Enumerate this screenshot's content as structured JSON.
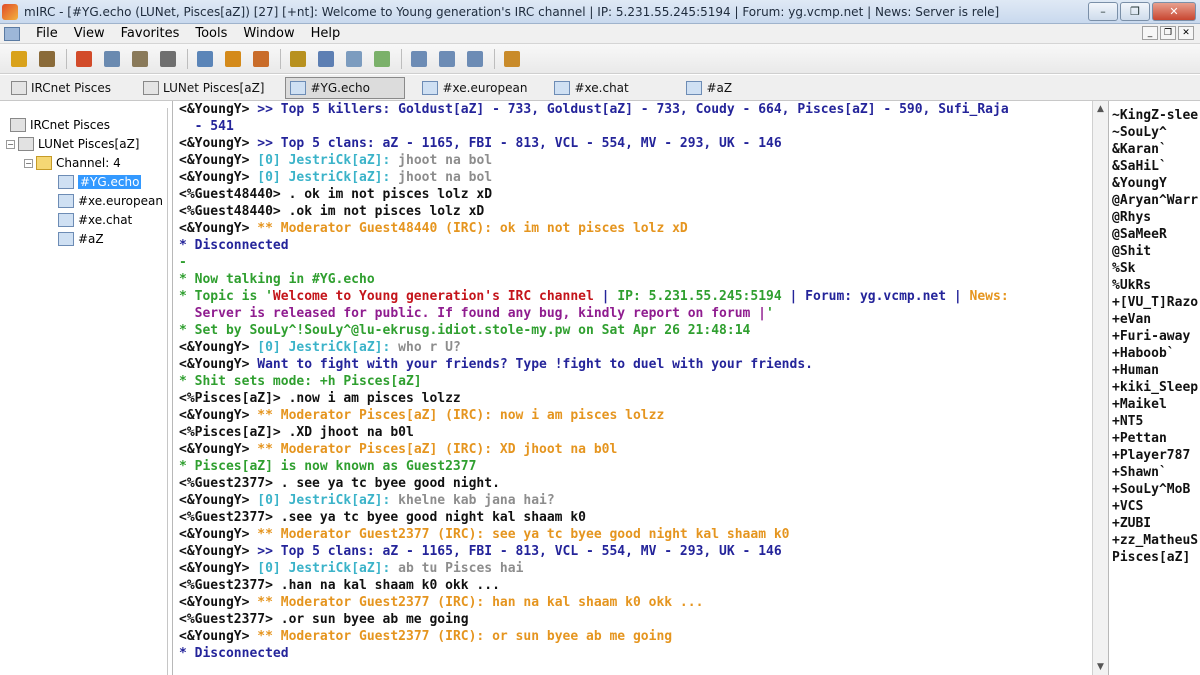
{
  "window": {
    "title": "mIRC - [#YG.echo (LUNet, Pisces[aZ]) [27] [+nt]: Welcome to Young generation's IRC channel | IP: 5.231.55.245:5194 | Forum: yg.vcmp.net | News: Server is rele]",
    "minimize": "–",
    "maximize": "❐",
    "close": "✕"
  },
  "menu": {
    "items": [
      "File",
      "View",
      "Favorites",
      "Tools",
      "Window",
      "Help"
    ],
    "mdi": [
      "_",
      "❐",
      "✕"
    ]
  },
  "toolbar": {
    "buttons": [
      {
        "icon": "connect-icon",
        "color": "#d9a21b"
      },
      {
        "icon": "options-icon",
        "color": "#8a6b3a"
      },
      {
        "icon": "favorites-icon",
        "color": "#d24b2a"
      },
      {
        "icon": "address-book-icon",
        "color": "#6a8ab0"
      },
      {
        "icon": "scripts-editor-icon",
        "color": "#8a7a5a"
      },
      {
        "icon": "colors-icon",
        "color": "#6f6f6f"
      },
      {
        "icon": "timer-icon",
        "color": "#5b85b8"
      },
      {
        "icon": "channel-list-icon",
        "color": "#d48a1a"
      },
      {
        "icon": "channel-folder-icon",
        "color": "#c96c2a"
      },
      {
        "icon": "dcc-send-icon",
        "color": "#b8911f"
      },
      {
        "icon": "dcc-chat-icon",
        "color": "#5d7fb3"
      },
      {
        "icon": "notify-list-icon",
        "color": "#7c9cbf"
      },
      {
        "icon": "url-list-icon",
        "color": "#7bb16a"
      },
      {
        "icon": "tile-horizontal-icon",
        "color": "#6d8cb5"
      },
      {
        "icon": "tile-vertical-icon",
        "color": "#6d8cb5"
      },
      {
        "icon": "cascade-icon",
        "color": "#6d8cb5"
      },
      {
        "icon": "help-icon",
        "color": "#c98b2a"
      }
    ]
  },
  "switchbar": {
    "tabs": [
      {
        "label": "IRCnet Pisces",
        "type": "server",
        "active": false
      },
      {
        "label": "LUNet Pisces[aZ]",
        "type": "server",
        "active": false
      },
      {
        "label": "#YG.echo",
        "type": "channel",
        "active": true
      },
      {
        "label": "#xe.european",
        "type": "channel",
        "active": false
      },
      {
        "label": "#xe.chat",
        "type": "channel",
        "active": false
      },
      {
        "label": "#aZ",
        "type": "channel",
        "active": false
      }
    ]
  },
  "treebar": {
    "server1": "IRCnet Pisces",
    "server2": "LUNet Pisces[aZ]",
    "folder": "Channel: 4",
    "channels": [
      "#YG.echo",
      "#xe.european",
      "#xe.chat",
      "#aZ"
    ],
    "expand_minus": "−",
    "expand_plus": "+"
  },
  "chat": {
    "lines": [
      [
        [
          "c-black",
          "<&YoungY> "
        ],
        [
          "c-darkblue",
          ">> Top 5 killers: Goldust[aZ] - 733, Goldust[aZ] - 733, Coudy - 664, Pisces[aZ] - 590, Sufi_Raja"
        ]
      ],
      [
        [
          "c-darkblue",
          "  - 541"
        ]
      ],
      [
        [
          "c-black",
          "<&YoungY> "
        ],
        [
          "c-darkblue",
          ">> Top 5 clans: aZ - 1165, FBI - 813, VCL - 554, MV - 293, UK - 146"
        ]
      ],
      [
        [
          "c-black",
          "<&YoungY> "
        ],
        [
          "c-cyan",
          "[0] JestriCk[aZ]: "
        ],
        [
          "c-grey",
          "jhoot na bol"
        ]
      ],
      [
        [
          "c-black",
          "<&YoungY> "
        ],
        [
          "c-cyan",
          "[0] JestriCk[aZ]: "
        ],
        [
          "c-grey",
          "jhoot na bol"
        ]
      ],
      [
        [
          "c-black",
          "<%Guest48440> . ok im not pisces lolz xD"
        ]
      ],
      [
        [
          "c-black",
          "<%Guest48440> .ok im not pisces lolz xD"
        ]
      ],
      [
        [
          "c-black",
          "<&YoungY> "
        ],
        [
          "c-orange",
          "** Moderator Guest48440 (IRC): ok im not pisces lolz xD"
        ]
      ],
      [
        [
          "c-darkblue",
          "* Disconnected"
        ]
      ],
      [
        [
          "c-green",
          "-"
        ]
      ],
      [
        [
          "c-green",
          "* Now talking in #YG.echo"
        ]
      ],
      [
        [
          "c-green",
          "* Topic is '"
        ],
        [
          "c-red",
          "Welcome to Young generation's IRC channel"
        ],
        [
          "c-darkblue",
          " | "
        ],
        [
          "c-green",
          "IP: 5.231.55.245:5194"
        ],
        [
          "c-darkblue",
          " | Forum: yg.vcmp.net | "
        ],
        [
          "c-orange",
          "News:"
        ]
      ],
      [
        [
          "c-purple",
          "  Server is released for public. If found any bug, kindly report on forum |"
        ],
        [
          "c-green",
          "'"
        ]
      ],
      [
        [
          "c-green",
          "* Set by SouLy^!SouLy^@lu-ekrusg.idiot.stole-my.pw on Sat Apr 26 21:48:14"
        ]
      ],
      [
        [
          "c-black",
          "<&YoungY> "
        ],
        [
          "c-cyan",
          "[0] JestriCk[aZ]: "
        ],
        [
          "c-grey",
          "who r U?"
        ]
      ],
      [
        [
          "c-black",
          "<&YoungY> "
        ],
        [
          "c-darkblue",
          "Want to fight with your friends? Type !fight to duel with your friends."
        ]
      ],
      [
        [
          "c-green",
          "* Shit sets mode: +h Pisces[aZ]"
        ]
      ],
      [
        [
          "c-black",
          "<%Pisces[aZ]> .now i am pisces lolzz"
        ]
      ],
      [
        [
          "c-black",
          "<&YoungY> "
        ],
        [
          "c-orange",
          "** Moderator Pisces[aZ] (IRC): now i am pisces lolzz"
        ]
      ],
      [
        [
          "c-black",
          "<%Pisces[aZ]> .XD jhoot na b0l"
        ]
      ],
      [
        [
          "c-black",
          "<&YoungY> "
        ],
        [
          "c-orange",
          "** Moderator Pisces[aZ] (IRC): XD jhoot na b0l"
        ]
      ],
      [
        [
          "c-green",
          "* Pisces[aZ] is now known as Guest2377"
        ]
      ],
      [
        [
          "c-black",
          "<%Guest2377> . see ya tc byee good night."
        ]
      ],
      [
        [
          "c-black",
          "<&YoungY> "
        ],
        [
          "c-cyan",
          "[0] JestriCk[aZ]: "
        ],
        [
          "c-grey",
          "khelne kab jana hai?"
        ]
      ],
      [
        [
          "c-black",
          "<%Guest2377> .see ya tc byee good night kal shaam k0"
        ]
      ],
      [
        [
          "c-black",
          "<&YoungY> "
        ],
        [
          "c-orange",
          "** Moderator Guest2377 (IRC): see ya tc byee good night kal shaam k0"
        ]
      ],
      [
        [
          "c-black",
          "<&YoungY> "
        ],
        [
          "c-darkblue",
          ">> Top 5 clans: aZ - 1165, FBI - 813, VCL - 554, MV - 293, UK - 146"
        ]
      ],
      [
        [
          "c-black",
          "<&YoungY> "
        ],
        [
          "c-cyan",
          "[0] JestriCk[aZ]: "
        ],
        [
          "c-grey",
          "ab tu Pisces hai"
        ]
      ],
      [
        [
          "c-black",
          "<%Guest2377> .han na kal shaam k0 okk ..."
        ]
      ],
      [
        [
          "c-black",
          "<&YoungY> "
        ],
        [
          "c-orange",
          "** Moderator Guest2377 (IRC): han na kal shaam k0 okk ..."
        ]
      ],
      [
        [
          "c-black",
          "<%Guest2377> .or sun byee ab me going"
        ]
      ],
      [
        [
          "c-black",
          "<&YoungY> "
        ],
        [
          "c-orange",
          "** Moderator Guest2377 (IRC): or sun byee ab me going"
        ]
      ],
      [
        [
          "c-darkblue",
          "* Disconnected"
        ]
      ]
    ]
  },
  "nicklist": {
    "nicks": [
      "~KingZ-slee",
      "~SouLy^",
      "&Karan`",
      "&SaHiL`",
      "&YoungY",
      "@Aryan^Warr",
      "@Rhys",
      "@SaMeeR",
      "@Shit",
      "%Sk",
      "%UkRs",
      "+[VU_T]Razo",
      "+eVan",
      "+Furi-away",
      "+Haboob`",
      "+Human",
      "+kiki_Sleep",
      "+Maikel",
      "+NT5",
      "+Pettan",
      "+Player787",
      "+Shawn`",
      "+SouLy^MoB",
      "+VCS",
      "+ZUBI",
      "+zz_MatheuS",
      "Pisces[aZ]"
    ]
  },
  "scrollbar": {
    "up": "▲",
    "down": "▼"
  }
}
